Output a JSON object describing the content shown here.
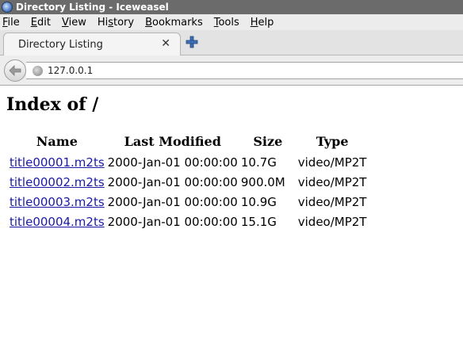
{
  "window": {
    "title": "Directory Listing - Iceweasel"
  },
  "menubar": {
    "items": [
      {
        "underline": "F",
        "rest": "ile"
      },
      {
        "underline": "E",
        "rest": "dit"
      },
      {
        "underline": "V",
        "rest": "iew"
      },
      {
        "pre": "Hi",
        "underline": "s",
        "rest": "tory"
      },
      {
        "underline": "B",
        "rest": "ookmarks"
      },
      {
        "underline": "T",
        "rest": "ools"
      },
      {
        "underline": "H",
        "rest": "elp"
      }
    ]
  },
  "tabs": {
    "active_label": "Directory Listing",
    "close_glyph": "✕"
  },
  "navbar": {
    "url": "127.0.0.1"
  },
  "page": {
    "heading": "Index of /",
    "columns": [
      "Name",
      "Last Modified",
      "Size",
      "Type"
    ],
    "rows": [
      {
        "name": "title00001.m2ts",
        "modified": "2000-Jan-01 00:00:00",
        "size": "10.7G",
        "type": "video/MP2T"
      },
      {
        "name": "title00002.m2ts",
        "modified": "2000-Jan-01 00:00:00",
        "size": "900.0M",
        "type": "video/MP2T"
      },
      {
        "name": "title00003.m2ts",
        "modified": "2000-Jan-01 00:00:00",
        "size": "10.9G",
        "type": "video/MP2T"
      },
      {
        "name": "title00004.m2ts",
        "modified": "2000-Jan-01 00:00:00",
        "size": "15.1G",
        "type": "video/MP2T"
      }
    ]
  },
  "colors": {
    "link": "#1a1aa6",
    "titlebar": "#6b6b6b"
  },
  "icons": {
    "app": "iceweasel-icon",
    "back": "back-arrow-icon",
    "site": "globe-icon",
    "new_tab": "plus-icon"
  }
}
